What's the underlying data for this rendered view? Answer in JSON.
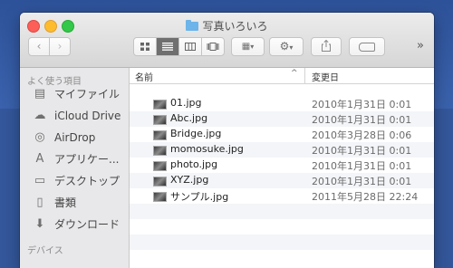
{
  "window": {
    "title": "写真いろいろ"
  },
  "toolbar": {
    "back": "‹",
    "forward": "›",
    "view_modes": [
      "icon-view",
      "list-view",
      "column-view",
      "coverflow-view"
    ],
    "more": "»"
  },
  "sidebar": {
    "favorites_header": "よく使う項目",
    "items": [
      {
        "label": "マイファイル",
        "icon": "all-files-icon"
      },
      {
        "label": "iCloud Drive",
        "icon": "cloud-icon"
      },
      {
        "label": "AirDrop",
        "icon": "airdrop-icon"
      },
      {
        "label": "アプリケー...",
        "icon": "applications-icon"
      },
      {
        "label": "デスクトップ",
        "icon": "desktop-icon"
      },
      {
        "label": "書類",
        "icon": "documents-icon"
      },
      {
        "label": "ダウンロード",
        "icon": "downloads-icon"
      }
    ],
    "devices_header": "デバイス"
  },
  "list": {
    "columns": {
      "name": "名前",
      "date": "変更日"
    },
    "files": [
      {
        "name": "01.jpg",
        "date": "2010年1月31日 0:01"
      },
      {
        "name": "Abc.jpg",
        "date": "2010年1月31日 0:01"
      },
      {
        "name": "Bridge.jpg",
        "date": "2010年3月28日 0:06"
      },
      {
        "name": "momosuke.jpg",
        "date": "2010年1月31日 0:01"
      },
      {
        "name": "photo.jpg",
        "date": "2010年1月31日 0:01"
      },
      {
        "name": "XYZ.jpg",
        "date": "2010年1月31日 0:01"
      },
      {
        "name": "サンプル.jpg",
        "date": "2011年5月28日 22:24"
      }
    ]
  }
}
